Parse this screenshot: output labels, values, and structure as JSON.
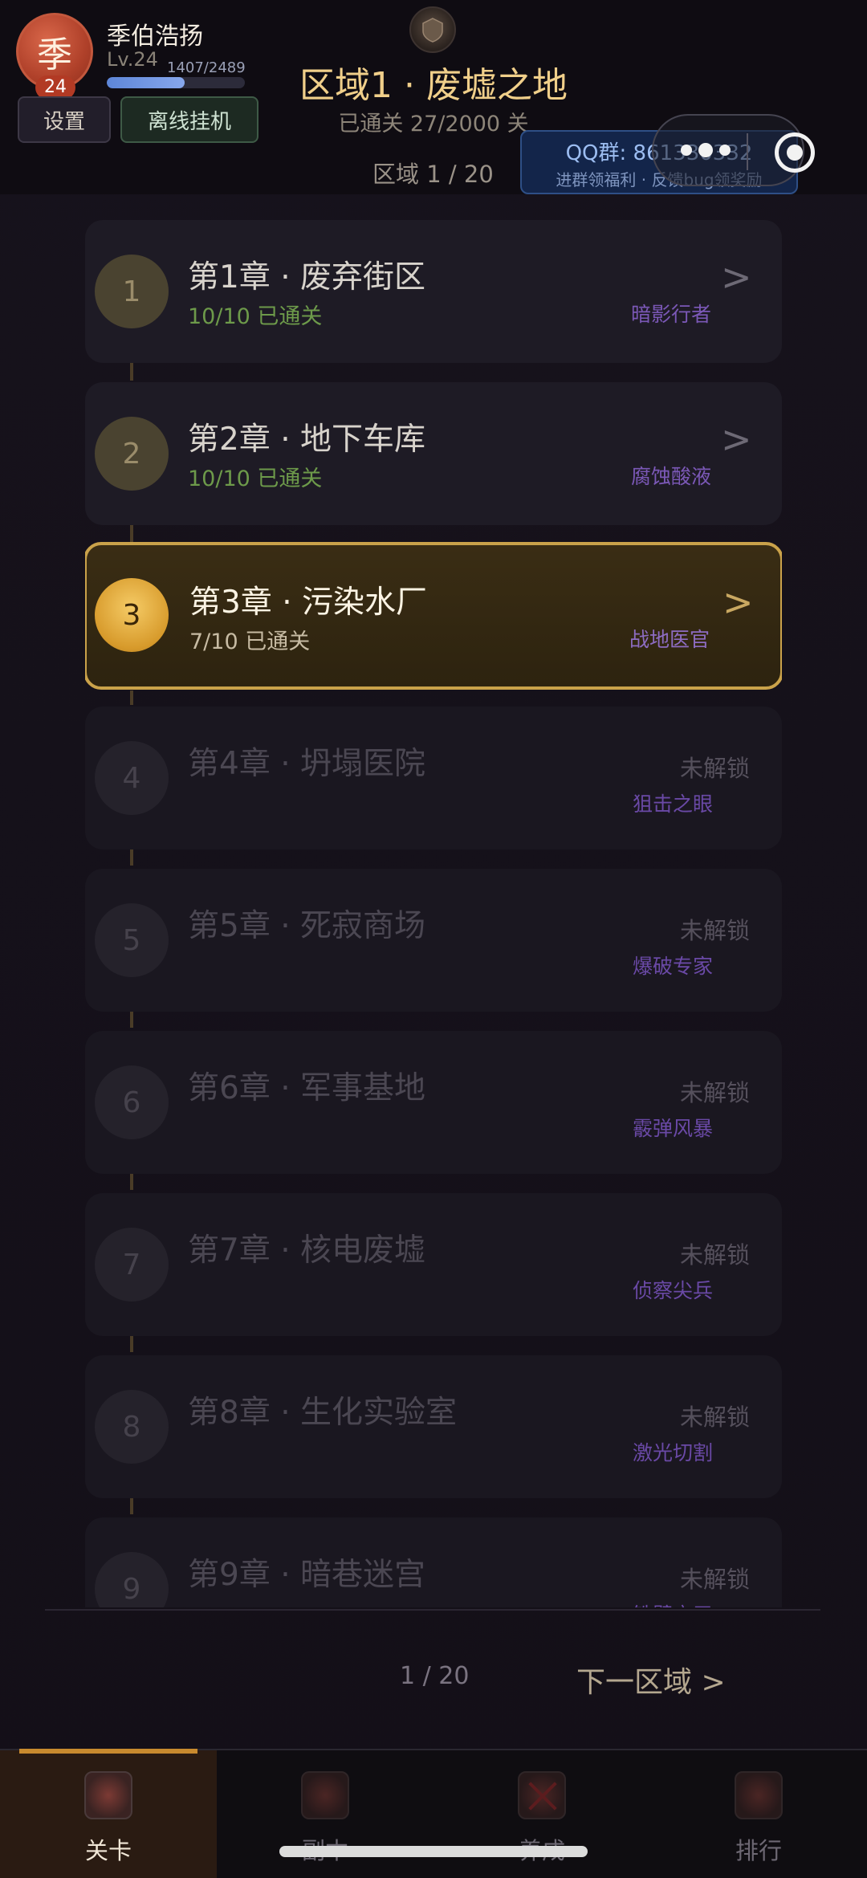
{
  "user": {
    "avatar_char": "季",
    "level_badge": "24",
    "name": "季伯浩扬",
    "level": "Lv.24",
    "xp_text": "1407/2489",
    "xp_progress": 0.565
  },
  "buttons": {
    "settings": "设置",
    "offline": "离线挂机"
  },
  "region": {
    "title": "区域1 · 废墟之地",
    "progress": "已通关 27/2000 关",
    "index": "区域 1 / 20"
  },
  "qq": {
    "line1": "QQ群: 861330332",
    "line2": "进群领福利 · 反馈bug领奖励"
  },
  "chapters": [
    {
      "num": "1",
      "name": "第1章 · 废弃街区",
      "status": "10/10 已通关",
      "reward": "暗影行者",
      "arrow": ">"
    },
    {
      "num": "2",
      "name": "第2章 · 地下车库",
      "status": "10/10 已通关",
      "reward": "腐蚀酸液",
      "arrow": ">"
    },
    {
      "num": "3",
      "name": "第3章 · 污染水厂",
      "status": "7/10 已通关",
      "reward": "战地医官",
      "arrow": ">"
    },
    {
      "num": "4",
      "name": "第4章 · 坍塌医院",
      "locked": "未解锁",
      "reward": "狙击之眼"
    },
    {
      "num": "5",
      "name": "第5章 · 死寂商场",
      "locked": "未解锁",
      "reward": "爆破专家"
    },
    {
      "num": "6",
      "name": "第6章 · 军事基地",
      "locked": "未解锁",
      "reward": "霰弹风暴"
    },
    {
      "num": "7",
      "name": "第7章 · 核电废墟",
      "locked": "未解锁",
      "reward": "侦察尖兵"
    },
    {
      "num": "8",
      "name": "第8章 · 生化实验室",
      "locked": "未解锁",
      "reward": "激光切割"
    },
    {
      "num": "9",
      "name": "第9章 · 暗巷迷宫",
      "locked": "未解锁",
      "reward": "铁壁守卫"
    }
  ],
  "pagination": {
    "page": "1 / 20",
    "next": "下一区域 >"
  },
  "tabs": [
    {
      "label": "关卡",
      "icon": "stage-icon"
    },
    {
      "label": "副本",
      "icon": "dungeon-icon"
    },
    {
      "label": "养成",
      "icon": "upgrade-icon"
    },
    {
      "label": "排行",
      "icon": "ranking-icon"
    }
  ]
}
